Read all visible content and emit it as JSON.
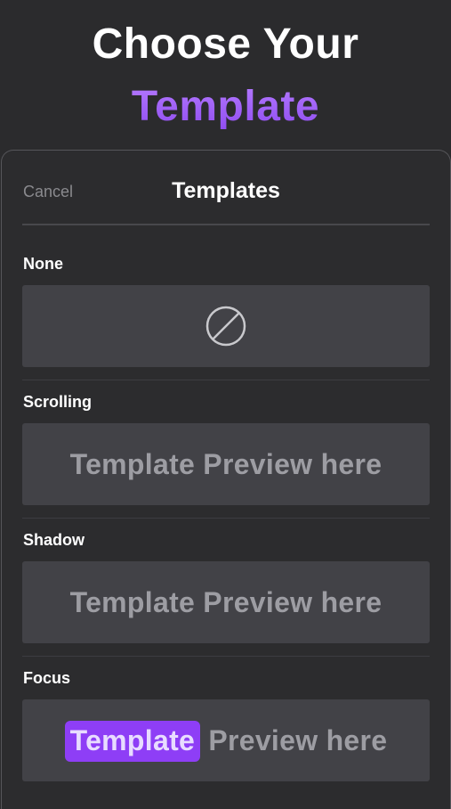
{
  "hero": {
    "line1": "Choose Your",
    "line2": "Template"
  },
  "sheet": {
    "cancel_label": "Cancel",
    "title": "Templates"
  },
  "options": [
    {
      "label": "None",
      "icon": "prohibited-icon"
    },
    {
      "label": "Scrolling",
      "preview": "Template Preview here"
    },
    {
      "label": "Shadow",
      "preview": "Template Preview here"
    },
    {
      "label": "Focus",
      "preview_highlight": "Template",
      "preview_rest": "Preview here"
    }
  ],
  "colors": {
    "background": "#2b2b2d",
    "accent": "#8e3ef6",
    "preview_bg": "#424247"
  }
}
